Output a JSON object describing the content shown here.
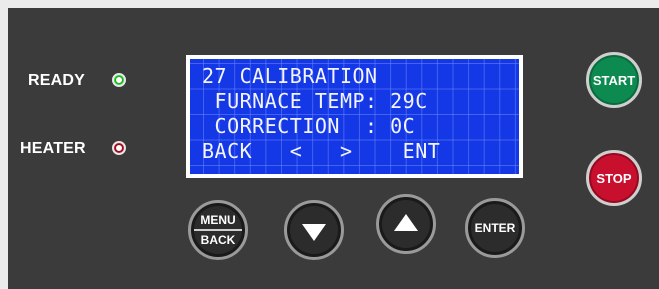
{
  "indicators": [
    {
      "label": "READY",
      "color": "#2fd42f"
    },
    {
      "label": "HEATER",
      "color": "#c01226"
    }
  ],
  "lcd": {
    "lines": [
      "27 CALIBRATION",
      " FURNACE TEMP: 29C",
      " CORRECTION  : 0C",
      "BACK   <   >    ENT"
    ],
    "background": "#1538e6"
  },
  "buttons": {
    "menu_top": "MENU",
    "menu_bottom": "BACK",
    "down_icon": "down-arrow-icon",
    "up_icon": "up-arrow-icon",
    "enter": "ENTER",
    "start": "START",
    "stop": "STOP"
  },
  "colors": {
    "start": "#0d8a4f",
    "stop": "#c8102e",
    "panel": "#3b3b3b"
  }
}
